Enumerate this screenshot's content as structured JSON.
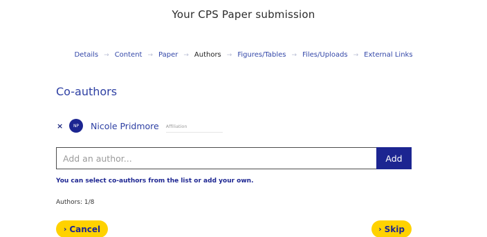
{
  "page": {
    "title": "Your CPS Paper submission"
  },
  "steps": [
    {
      "label": "Details"
    },
    {
      "label": "Content"
    },
    {
      "label": "Paper"
    },
    {
      "label": "Authors"
    },
    {
      "label": "Figures/Tables"
    },
    {
      "label": "Files/Uploads"
    },
    {
      "label": "External Links"
    }
  ],
  "step_separator": "→",
  "section": {
    "title": "Co-authors"
  },
  "coauthor": {
    "remove_symbol": "×",
    "initials": "NP",
    "name": "Nicole Pridmore",
    "affiliation_placeholder": "Affiliation"
  },
  "author_input": {
    "placeholder": "Add an author...",
    "value": ""
  },
  "add_button": {
    "label": "Add"
  },
  "hint": "You can select co-authors from the list or add your own.",
  "authors_count": "Authors: 1/8",
  "cancel_button": {
    "chevron": "›",
    "label": "Cancel"
  },
  "skip_button": {
    "chevron": "›",
    "label": "Skip"
  },
  "colors": {
    "primary": "#1c2591",
    "accent": "#ffd200",
    "link": "#3347a8"
  }
}
